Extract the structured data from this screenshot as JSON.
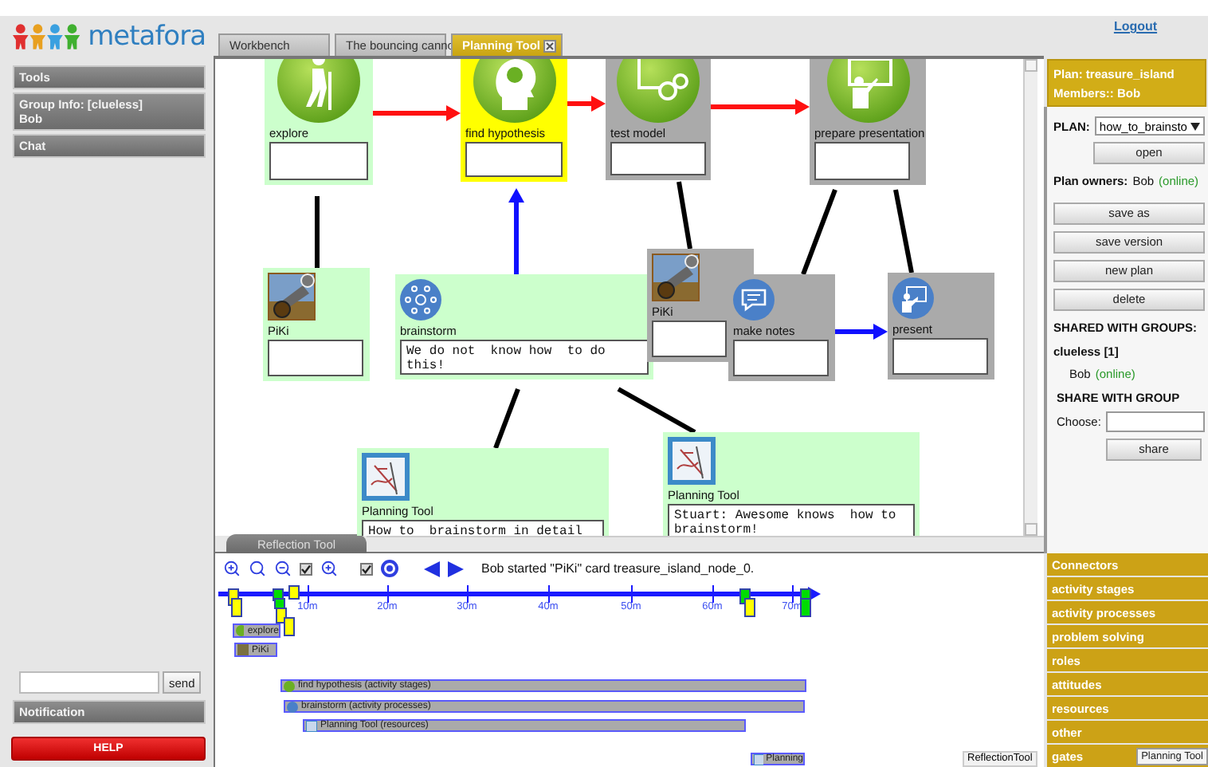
{
  "header": {
    "logo_text": "metafora",
    "logout": "Logout"
  },
  "sidebar": {
    "sections": [
      {
        "label": "Tools"
      },
      {
        "label": "Group Info: [clueless]",
        "sublabel": "Bob"
      },
      {
        "label": "Chat"
      }
    ],
    "chat_send": "send",
    "notification": "Notification",
    "help": "HELP"
  },
  "tabs": [
    {
      "label": "Workbench",
      "selected": false
    },
    {
      "label": "The bouncing canno",
      "selected": false
    },
    {
      "label": "Planning Tool",
      "selected": true
    }
  ],
  "plan_nodes": [
    {
      "kind": "stage",
      "label": "explore",
      "color": "#ccffcc"
    },
    {
      "kind": "stage",
      "label": "find hypothesis",
      "color": "#ffff00"
    },
    {
      "kind": "stage",
      "label": "test model",
      "color": "#aaaaaa"
    },
    {
      "kind": "stage",
      "label": "prepare presentation",
      "color": "#aaaaaa"
    },
    {
      "kind": "simulation",
      "label": "PiKi",
      "color": "#ccffcc"
    },
    {
      "kind": "process",
      "label": "brainstorm",
      "color": "#ccffcc",
      "text": "We do not  know how  to do this!"
    },
    {
      "kind": "simulation",
      "label": "PiKi",
      "color": "#aaaaaa"
    },
    {
      "kind": "process",
      "label": "make notes",
      "color": "#aaaaaa"
    },
    {
      "kind": "process",
      "label": "present",
      "color": "#aaaaaa"
    },
    {
      "kind": "tool",
      "label": "Planning Tool",
      "color": "#ccffcc",
      "text": "How to  brainstorm in detail"
    },
    {
      "kind": "tool",
      "label": "Planning Tool",
      "color": "#ccffcc",
      "text": "Stuart: Awesome knows  how to brainstorm!"
    }
  ],
  "reflection_tab": "Reflection Tool",
  "timeline": {
    "checkboxes": [
      {
        "checked": true
      },
      {
        "checked": true
      }
    ],
    "status": "Bob started \"PiKi\" card treasure_island_node_0.",
    "ticks": [
      "10m",
      "20m",
      "30m",
      "40m",
      "50m",
      "60m",
      "70m"
    ],
    "markers": [
      {
        "color": "#ffff00"
      },
      {
        "color": "#ffff00"
      },
      {
        "color": "#00dd00"
      },
      {
        "color": "#00dd00"
      },
      {
        "color": "#ffff00"
      },
      {
        "color": "#ffff00"
      },
      {
        "color": "#ffff00"
      },
      {
        "color": "#00dd00"
      },
      {
        "color": "#ffff00"
      },
      {
        "color": "#00dd00"
      },
      {
        "color": "#00dd00"
      }
    ],
    "events": [
      {
        "kind": "stage",
        "label": "explore"
      },
      {
        "kind": "simulation",
        "label": "PiKi"
      },
      {
        "kind": "stage",
        "label": "find hypothesis (activity stages)"
      },
      {
        "kind": "process",
        "label": "brainstorm (activity processes)"
      },
      {
        "kind": "tool",
        "label": "Planning Tool (resources)"
      },
      {
        "kind": "tool",
        "label": "Planning"
      }
    ],
    "footer": "ReflectionTool"
  },
  "plan_panel": {
    "plan": "Plan: treasure_island",
    "members": "Members:: Bob",
    "plan_label": "PLAN:",
    "plan_select": "how_to_brainsto",
    "open": "open",
    "owners_label": "Plan owners:",
    "owner": "Bob",
    "owner_status": "(online)",
    "actions": [
      "save as",
      "save version",
      "new plan",
      "delete"
    ],
    "shared_heading": "SHARED WITH GROUPS:",
    "group": "clueless [1]",
    "member": "Bob",
    "member_status": "(online)",
    "share_heading": "SHARE WITH GROUP",
    "choose_label": "Choose:",
    "share": "share"
  },
  "categories": [
    "Connectors",
    "activity stages",
    "activity processes",
    "problem solving",
    "roles",
    "attitudes",
    "resources",
    "other",
    "gates"
  ],
  "tooltip": "Planning Tool"
}
